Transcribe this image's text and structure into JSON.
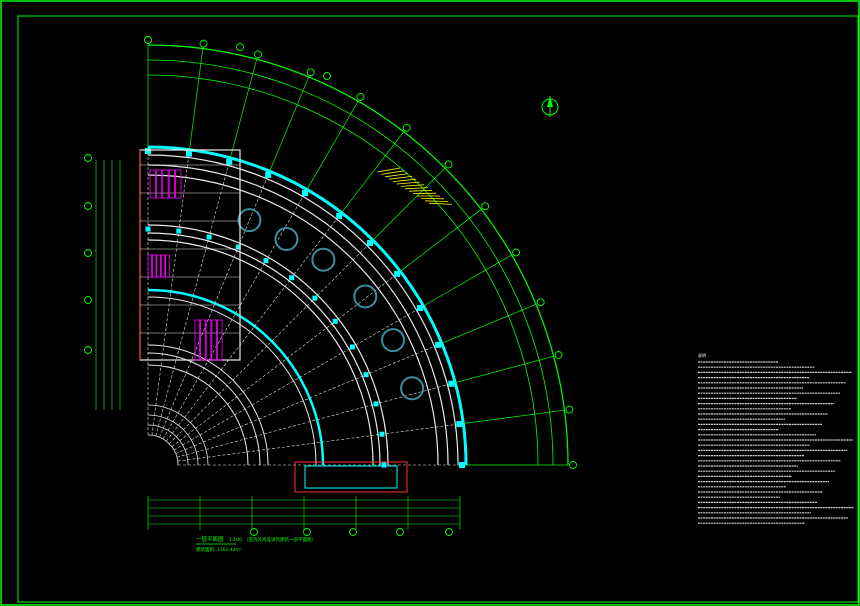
{
  "drawing": {
    "colors": {
      "frame": "#00ff00",
      "wall": "#e8e8e8",
      "corridor": "#00ffff",
      "axis": "#00ff00",
      "fixture": "#ff00ff",
      "stair": "#ffff00",
      "warning": "#ff3030",
      "dimension": "#00ff00"
    },
    "axis_bubbles_left": [
      "A",
      "B",
      "C",
      "D",
      "E",
      "F"
    ],
    "axis_bubbles_bottom": [
      "1",
      "2",
      "3",
      "4",
      "5"
    ],
    "radial_bubbles": [
      "1",
      "2",
      "3",
      "4",
      "5",
      "6",
      "7",
      "8",
      "9",
      "10",
      "11",
      "12"
    ],
    "north_symbol": "north-arrow",
    "title_block": {
      "title": "一层平面图",
      "scale": "1:100",
      "area": "建筑面积: 1562.44m²",
      "note": "（室内外高差详见建筑一层平面图）"
    },
    "notes_heading": "说明",
    "notes_lines": 32
  }
}
